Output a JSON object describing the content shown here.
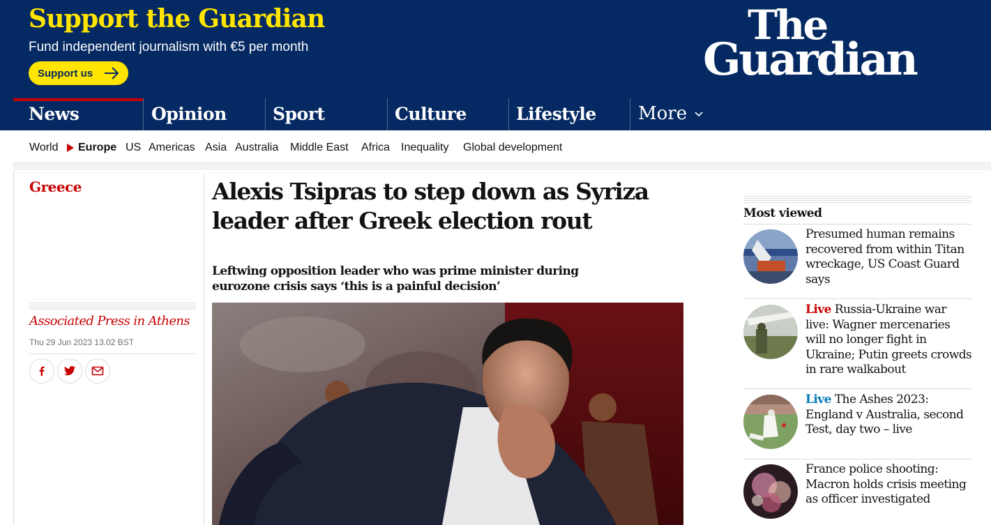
{
  "support": {
    "title": "Support the Guardian",
    "subtitle": "Fund independent journalism with €5 per month",
    "button_label": "Support us"
  },
  "logo": {
    "line1": "The",
    "line2": "Guardian"
  },
  "nav": {
    "pillars": [
      {
        "label": "News"
      },
      {
        "label": "Opinion"
      },
      {
        "label": "Sport"
      },
      {
        "label": "Culture"
      },
      {
        "label": "Lifestyle"
      }
    ],
    "more_label": "More"
  },
  "subnav": {
    "items": [
      "World",
      "Europe",
      "US",
      "Americas",
      "Asia",
      "Australia",
      "Middle East",
      "Africa",
      "Inequality",
      "Global development"
    ],
    "active": "Europe"
  },
  "article": {
    "kicker": "Greece",
    "headline": "Alexis Tsipras to step down as Syriza leader after Greek election rout",
    "standfirst": "Leftwing opposition leader who was prime minister during eurozone crisis says ‘this is a painful decision’",
    "byline": "Associated Press in Athens",
    "date": "Thu 29 Jun 2023 13.02 BST",
    "share_icons": [
      "facebook-icon",
      "twitter-icon",
      "email-icon"
    ]
  },
  "most_viewed": {
    "title": "Most viewed",
    "items": [
      {
        "live": "",
        "text": "Presumed human remains recovered from within Titan wreckage, US Coast Guard says"
      },
      {
        "live": "Live",
        "text": "Russia-Ukraine war live: Wagner mercenaries will no longer fight in Ukraine; Putin greets crowds in rare walkabout"
      },
      {
        "live": "Live",
        "text": "The Ashes 2023: England v Australia, second Test, day two – live"
      },
      {
        "live": "",
        "text": "France police shooting: Macron holds crisis meeting as officer investigated"
      }
    ]
  },
  "colors": {
    "brand_blue": "#052962",
    "support_yellow": "#ffe500",
    "news_red": "#c70000",
    "sport_blue": "#0077b6"
  }
}
